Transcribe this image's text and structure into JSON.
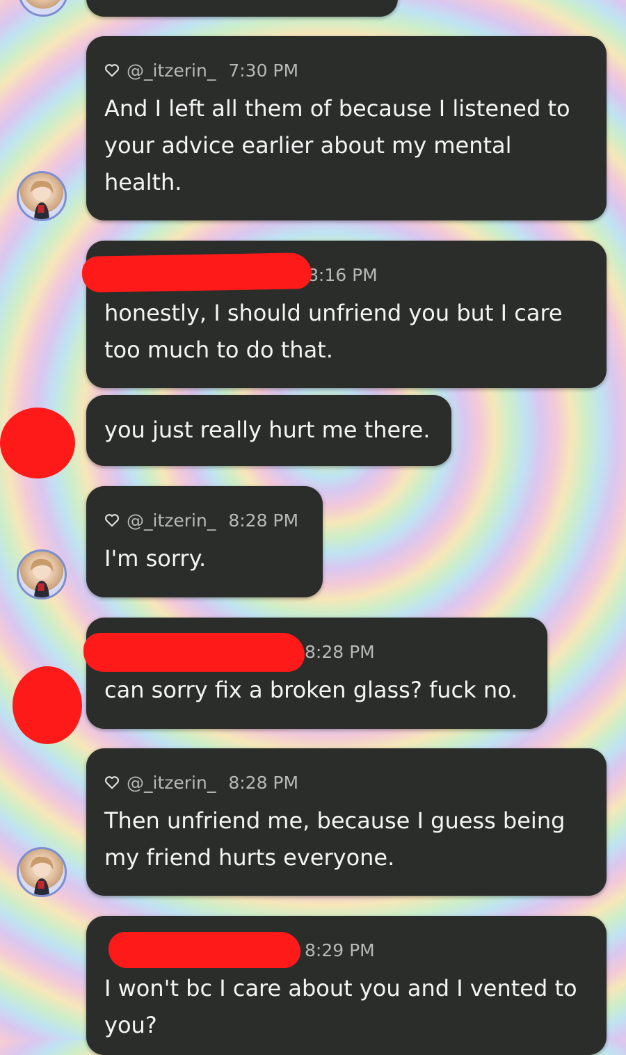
{
  "messages": [
    {
      "user": "@_itzerin_",
      "time": "7:30 PM",
      "text": "And I left all them of because I listened to your advice earlier about my mental health."
    },
    {
      "user": "",
      "time": "8:16 PM",
      "text": "honestly, I should unfriend you but I care too much to do that."
    },
    {
      "user": "",
      "time": "",
      "text": "you just really hurt me there."
    },
    {
      "user": "@_itzerin_",
      "time": "8:28 PM",
      "text": "I'm sorry."
    },
    {
      "user": "",
      "time": "8:28 PM",
      "text": "can sorry fix a broken glass? fuck no."
    },
    {
      "user": "@_itzerin_",
      "time": "8:28 PM",
      "text": "Then unfriend me, because I guess being my friend hurts everyone."
    },
    {
      "user": "",
      "time": "8:29 PM",
      "text": "I won't bc I care about you and I vented to you?"
    }
  ],
  "icons": {
    "heart": "heart-outline-icon",
    "avatar": "user-avatar"
  },
  "colors": {
    "bubble": "#2b2d2b",
    "redaction": "#ff1a1a",
    "meta_text": "#b8b8b8"
  }
}
